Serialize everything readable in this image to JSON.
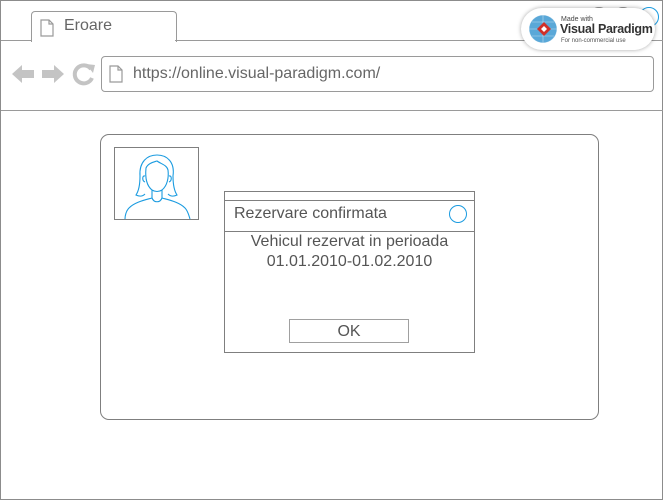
{
  "browser": {
    "tab": {
      "title": "Eroare",
      "icon": "document-icon"
    },
    "address": {
      "url": "https://online.visual-paradigm.com/",
      "icon": "document-icon"
    },
    "nav": {
      "back_icon": "arrow-left-icon",
      "forward_icon": "arrow-right-icon",
      "refresh_icon": "refresh-icon"
    }
  },
  "badge": {
    "made_with": "Made with",
    "brand": "Visual Paradigm",
    "subtitle": "For non-commercial use"
  },
  "avatar": {
    "icon": "user-portrait-icon"
  },
  "dialog": {
    "title": "Rezervare confirmata",
    "message_line1": "Vehicul rezervat in perioada",
    "message_line2": "01.01.2010-01.02.2010",
    "ok_label": "OK"
  },
  "colors": {
    "accent": "#1a9be0",
    "border": "#7f7f7f",
    "text": "#555555"
  }
}
